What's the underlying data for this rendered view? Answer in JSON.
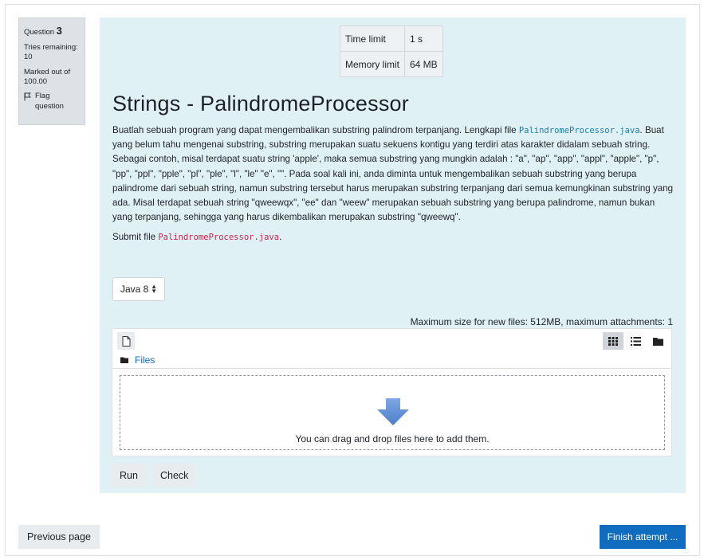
{
  "question": {
    "label": "Question",
    "number": "3",
    "tries": "Tries remaining: 10",
    "marked": "Marked out of 100.00",
    "flag_label": "Flag question"
  },
  "limits": [
    {
      "name": "Time limit",
      "value": "1 s"
    },
    {
      "name": "Memory limit",
      "value": "64 MB"
    }
  ],
  "title": "Strings - PalindromeProcessor",
  "description": {
    "p1_part1": "Buatlah sebuah program yang dapat mengembalikan substring palindrom terpanjang. Lengkapi file ",
    "p1_code": "PalindromeProcessor.java",
    "p1_part2": ". Buat yang belum tahu mengenai substring, substring merupakan suatu sekuens kontigu yang terdiri atas karakter didalam sebuah string. Sebagai contoh, misal terdapat suatu string 'apple', maka semua substring yang mungkin adalah : \"a\", \"ap\", \"app\", \"appl\", \"apple\", \"p\", \"pp\", \"ppl\", \"pple\", \"pl\", \"ple\", \"l\", \"le\" \"e\", \"\". Pada soal kali ini, anda diminta untuk mengembalikan sebuah substring yang berupa palindrome dari sebuah string, namun substring tersebut harus merupakan substring terpanjang dari semua kemungkinan substring yang ada. Misal terdapat sebuah string \"qweewqx\", \"ee\" dan \"weew\" merupakan sebuah substring yang berupa palindrome, namun bukan yang terpanjang, sehingga yang harus dikembalikan merupakan substring \"qweewq\".",
    "p2_part1": "Submit file ",
    "p2_code": "PalindromeProcessor.java",
    "p2_part2": "."
  },
  "language": {
    "selected": "Java 8"
  },
  "filemanager": {
    "max_size": "Maximum size for new files: 512MB, maximum attachments: 1",
    "crumb": "Files",
    "drop_message": "You can drag and drop files here to add them."
  },
  "buttons": {
    "run": "Run",
    "check": "Check",
    "previous": "Previous page",
    "finish": "Finish attempt ..."
  },
  "colors": {
    "content_bg": "#e0f1f6",
    "primary": "#0f6cbf",
    "drop_arrow": "#5b8dd6"
  },
  "icons": [
    "flag-icon",
    "file-icon",
    "grid-view-icon",
    "list-view-icon",
    "folder-view-icon",
    "folder-icon",
    "drop-arrow-icon",
    "select-arrows-icon"
  ]
}
